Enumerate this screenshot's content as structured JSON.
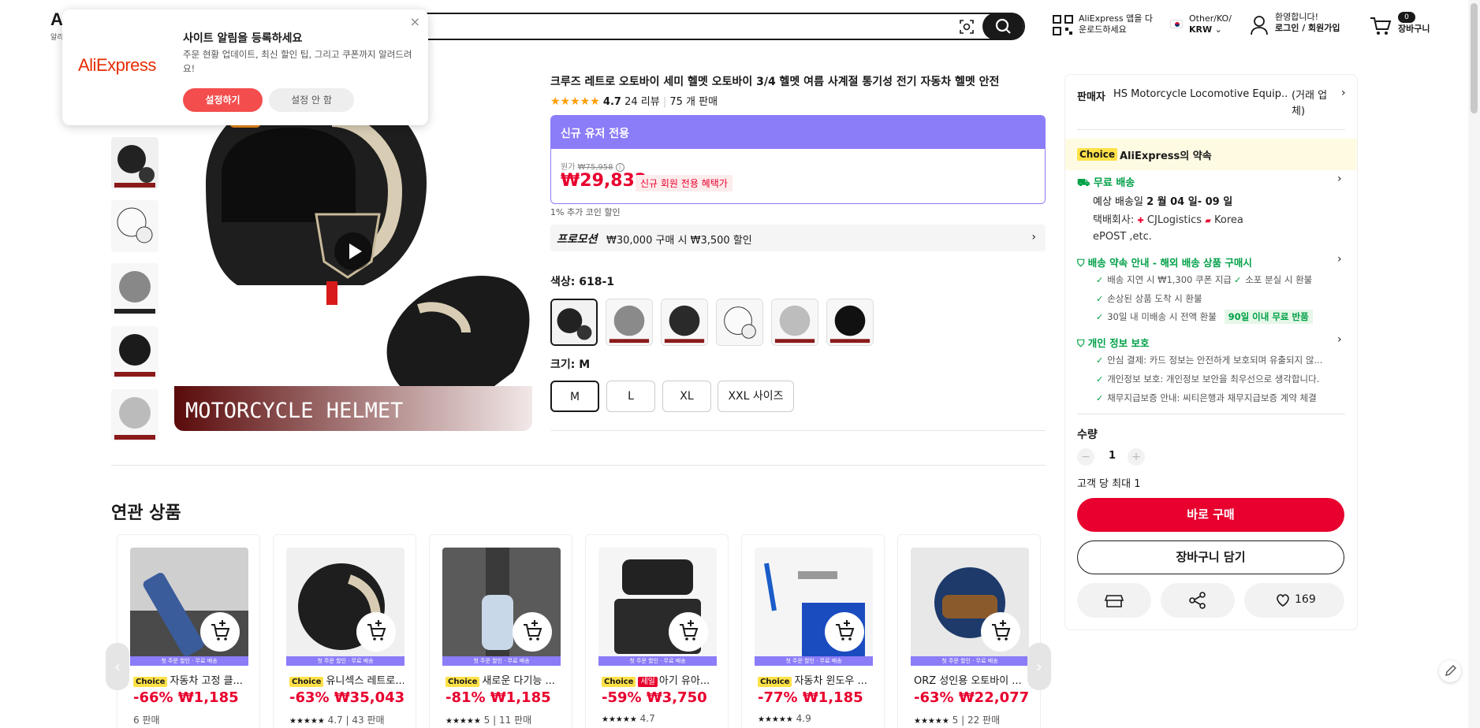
{
  "header": {
    "search_placeholder": "",
    "app_download": [
      "AliExpress 앱을 다",
      "운로드하세요"
    ],
    "region_top": "Other/KO/",
    "region_currency": "KRW",
    "greeting": "환영합니다!",
    "login": "로그인 / 회원가입",
    "cart_count": "0",
    "cart_label": "장바구니",
    "logo_sub": "알리"
  },
  "notification": {
    "brand": "AliExpress",
    "title": "사이트 알림을 등록하세요",
    "desc": "주문 현황 업데이트, 최신 할인 팁, 그리고 쿠폰까지 알려드려요!",
    "allow": "설정하기",
    "deny": "설정 안 함",
    "close": "×"
  },
  "product": {
    "title": "크루즈 레트로 오토바이 세미 헬멧 오토바이 3/4 헬멧 여름 사계절 통기성 전기 자동차 헬멧 안전",
    "rating": "4.7",
    "reviews": "24 리뷰",
    "sold": "75 개 판매",
    "promo_head": "신규 유저 전용",
    "orig_label": "원가",
    "orig_price": "₩75,958",
    "price": "₩29,832",
    "price_tag": "신규 회원 전용 혜택가",
    "coin": "1% 추가 코인 할인",
    "promotion_label": "프로모션",
    "promotion_text": "₩30,000 구매 시 ₩3,500 할인",
    "color_label": "색상: 618-1",
    "size_label": "크기: M",
    "sizes": [
      "M",
      "L",
      "XL",
      "XXL 사이즈"
    ],
    "banner_text": "MOTORCYCLE HELMET"
  },
  "related": {
    "title": "연관 상품",
    "strip": "첫 주문 할인 · 무료 배송",
    "items": [
      {
        "choice": "Choice",
        "sale": "",
        "name": "자동차 고정 클...",
        "price": "-66% ₩1,185",
        "meta": "6 판매"
      },
      {
        "choice": "Choice",
        "sale": "",
        "name": "유니섹스 레트로...",
        "price": "-63% ₩35,043",
        "meta": "4.7 | 43 판매"
      },
      {
        "choice": "Choice",
        "sale": "",
        "name": "새로운 다기능 ...",
        "price": "-81% ₩1,185",
        "meta": "5 | 11 판매"
      },
      {
        "choice": "Choice",
        "sale": "세일",
        "name": "아기 유아...",
        "price": "-59% ₩3,750",
        "meta": "4.7"
      },
      {
        "choice": "Choice",
        "sale": "",
        "name": "자동차 윈도우 ...",
        "price": "-77% ₩1,185",
        "meta": "4.9"
      },
      {
        "choice": "",
        "sale": "",
        "name": "ORZ 성인용 오토바이 ...",
        "price": "-63% ₩22,077",
        "meta": "5 | 22 판매"
      }
    ]
  },
  "panel": {
    "seller_label": "판매자",
    "seller_name": "HS Motorcycle Locomotive Equip...",
    "seller_type": "(거래 업체)",
    "choice_badge": "Choice",
    "promise": "AliExpress의 약속",
    "free_ship": "무료 배송",
    "delivery_prefix": "예상 배송일",
    "delivery_date": "2 월 04 일- 09 일",
    "carrier_label": "택배회사:",
    "carrier_1": "CJLogistics",
    "carrier_2": "Korea",
    "carrier_3": "ePOST ,etc.",
    "ship_guarantee": "배송 약속 안내 - 해외 배송 상품 구매시",
    "g1": "배송 지연 시 ₩1,300 쿠폰 지급",
    "g2": "소포 분실 시 환불",
    "g3": "손상된 상품 도착 시 환불",
    "g4": "30일 내 미배송 시 전액 환불",
    "g4_badge": "90일 이내 무료 반품",
    "privacy": "개인 정보 보호",
    "p1": "안심 결제: 카드 정보는 안전하게 보호되며 유출되지 않...",
    "p2": "개인정보 보호: 개인정보 보안을 최우선으로 생각합니다.",
    "p3": "채무지급보증 안내: 씨티은행과 채무지급보증 계약 체결",
    "qty_label": "수량",
    "qty": "1",
    "qty_limit": "고객 당 최대 1",
    "buy": "바로 구매",
    "add_cart": "장바구니 담기",
    "wish_count": "169"
  },
  "colors": {
    "accent_red": "#e8002e",
    "promo_purple": "#8b7cf8",
    "choice_yellow": "#ffe148",
    "green": "#00a047"
  }
}
